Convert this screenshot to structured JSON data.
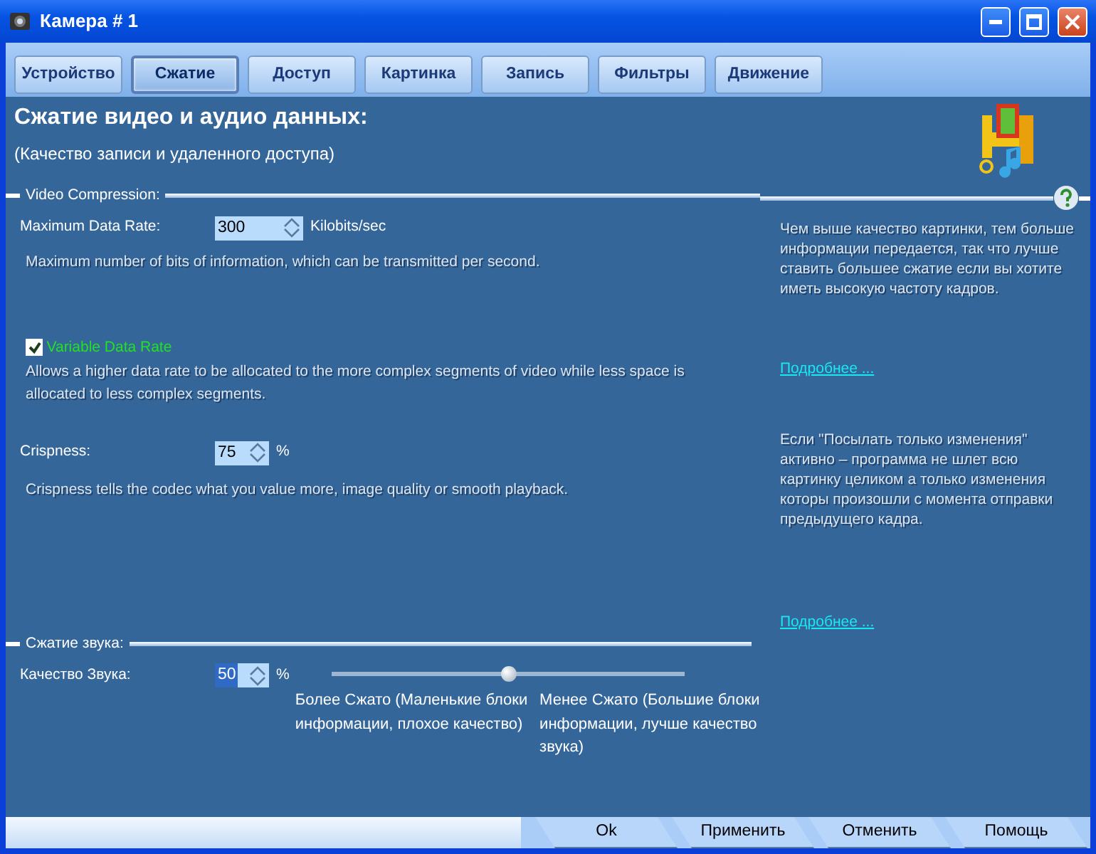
{
  "window": {
    "title": "Камера # 1"
  },
  "tabs": [
    {
      "label": "Устройство",
      "selected": false
    },
    {
      "label": "Сжатие",
      "selected": true
    },
    {
      "label": "Доступ",
      "selected": false
    },
    {
      "label": "Картинка",
      "selected": false
    },
    {
      "label": "Запись",
      "selected": false
    },
    {
      "label": "Фильтры",
      "selected": false
    },
    {
      "label": "Движение",
      "selected": false
    }
  ],
  "header": {
    "title": "Сжатие видео и аудио данных:",
    "subtitle": "(Качество записи и удаленного доступа)"
  },
  "video_section": {
    "title": "Video Compression:",
    "max_rate": {
      "label": "Maximum Data Rate:",
      "value": "300",
      "unit": "Kilobits/sec",
      "description": "Maximum number of bits of information, which can be transmitted per second."
    },
    "variable_rate": {
      "label": "Variable Data Rate",
      "checked": true,
      "description": "Allows a higher data rate to be allocated to the more complex segments of video while less space is allocated to less complex segments."
    },
    "crispness": {
      "label": "Crispness:",
      "value": "75",
      "unit": "%",
      "description": "Crispness tells the codec what you value more, image quality or smooth playback."
    }
  },
  "audio_section": {
    "title": "Сжатие звука:",
    "quality": {
      "label": "Качество Звука:",
      "value": "50",
      "unit": "%",
      "level": 0.5
    },
    "low_label": "Более Сжато (Маленькие блоки информации, плохое качество)",
    "high_label": "Менее Сжато (Большие блоки информации, лучше качество звука)"
  },
  "help_panel": [
    {
      "text": "Чем выше качество картинки, тем больше информации передается, так что лучше ставить большее сжатие если вы хотите иметь высокую частоту кадров.",
      "link": "Подробнее ..."
    },
    {
      "text": "Если \"Посылать только изменения\" активно – программа не шлет всю картинку целиком а только изменения которы произошли с момента отправки предыдущего кадра.",
      "link": "Подробнее ..."
    }
  ],
  "buttons": [
    "Ok",
    "Применить",
    "Отменить",
    "Помощь"
  ]
}
